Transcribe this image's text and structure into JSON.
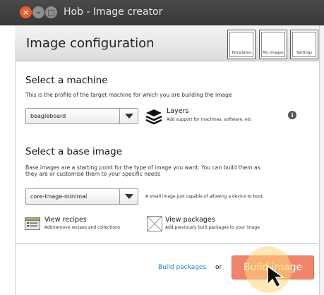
{
  "window": {
    "title": "Hob - Image creator",
    "close_glyph": "×",
    "min_glyph": "–",
    "max_glyph": "□"
  },
  "header": {
    "title": "Image configuration",
    "buttons": {
      "templates": "Templates",
      "my_images": "My images",
      "settings": "Settings"
    }
  },
  "machine": {
    "title": "Select a machine",
    "description": "This is the profile of the target machine for which you are building the image",
    "selected": "beagleboard",
    "layers_label": "Layers",
    "layers_desc": "Add support for machines, software, etc",
    "info_glyph": "i"
  },
  "base_image": {
    "title": "Select a base image",
    "description_line1": "Base images are a starting point for the type of image you want. You can build them as",
    "description_line2": "they are or customise them to your specific needs",
    "selected": "core-image-minimal",
    "selected_desc": "A small image just capable of allowing a device to boot."
  },
  "recipes": {
    "label": "View recipes",
    "desc": "Add/remove recipes and collections"
  },
  "packages": {
    "label": "View packages",
    "desc": "Add previously built packages to your image"
  },
  "footer": {
    "build_packages": "Build packages",
    "or": "or",
    "build_image": "Build image"
  },
  "colors": {
    "accent": "#f0856a",
    "link": "#1a7fcf",
    "close": "#f0592a"
  }
}
